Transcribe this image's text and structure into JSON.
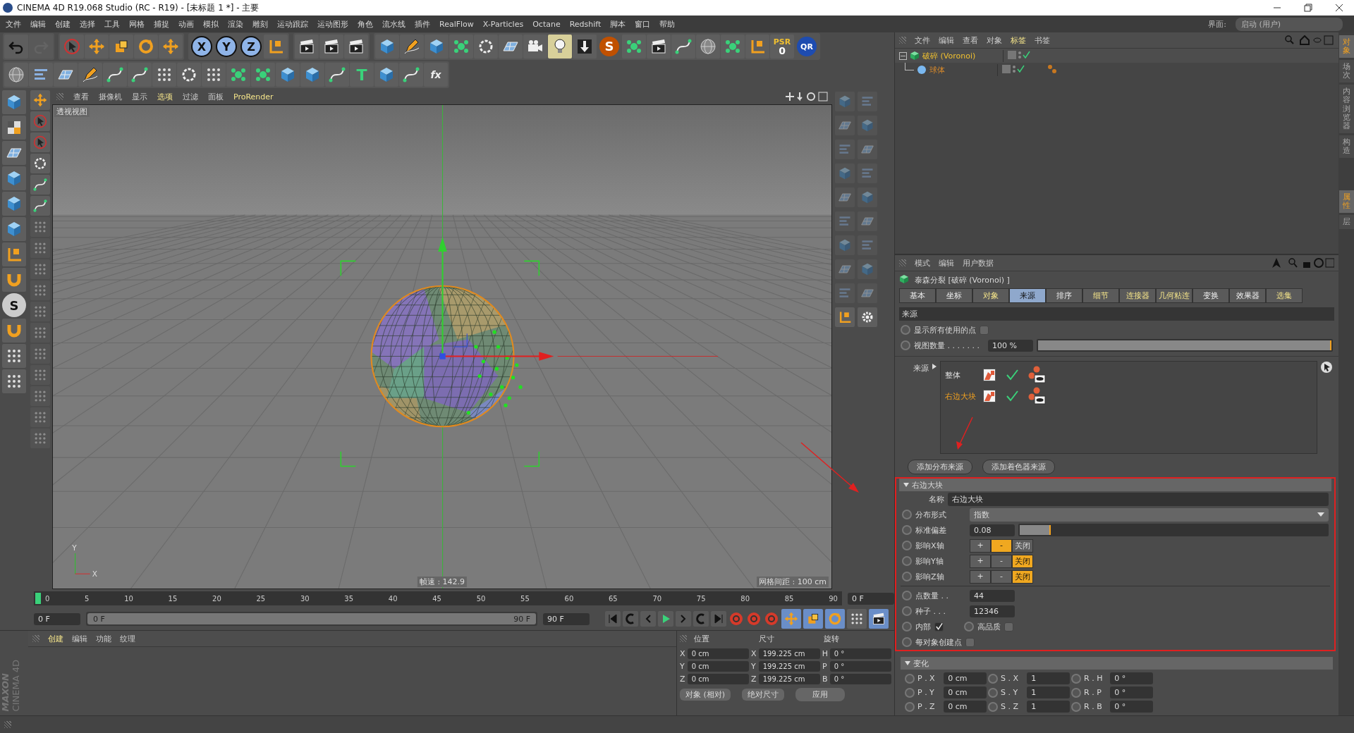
{
  "window": {
    "title": "CINEMA 4D R19.068 Studio (RC - R19) - [未标题 1 *] - 主要"
  },
  "menu": [
    "文件",
    "编辑",
    "创建",
    "选择",
    "工具",
    "网格",
    "捕捉",
    "动画",
    "模拟",
    "渲染",
    "雕刻",
    "运动跟踪",
    "运动图形",
    "角色",
    "流水线",
    "插件",
    "RealFlow",
    "X-Particles",
    "Octane",
    "Redshift",
    "脚本",
    "窗口",
    "帮助"
  ],
  "layout_selector": {
    "label": "界面:",
    "value": "启动 (用户)"
  },
  "toolbar": {
    "axis_buttons": [
      {
        "label": "X",
        "selected": true
      },
      {
        "label": "Y",
        "selected": true
      },
      {
        "label": "Z",
        "selected": true
      }
    ],
    "s_logo": "S",
    "psr": {
      "label": "PSR",
      "value": "0"
    },
    "qr": "QR",
    "text_tool": "T",
    "fx": "fx",
    "left_s": "S"
  },
  "viewport": {
    "menu": [
      {
        "label": "查看",
        "highlighted": false
      },
      {
        "label": "摄像机",
        "highlighted": false
      },
      {
        "label": "显示",
        "highlighted": false
      },
      {
        "label": "选项",
        "highlighted": true
      },
      {
        "label": "过滤",
        "highlighted": false
      },
      {
        "label": "面板",
        "highlighted": false
      },
      {
        "label": "ProRender",
        "highlighted": true
      }
    ],
    "view_name": "透视视图",
    "fps": "帧速 : 142.9",
    "grid_spacing": "网格间距 : 100 cm",
    "axis_labels": [
      "Y",
      "X"
    ]
  },
  "timeline": {
    "ticks": [
      "0",
      "5",
      "10",
      "15",
      "20",
      "25",
      "30",
      "35",
      "40",
      "45",
      "50",
      "55",
      "60",
      "65",
      "70",
      "75",
      "80",
      "85",
      "90"
    ],
    "current_frame": "0 F"
  },
  "transport": {
    "start": "0 F",
    "range": {
      "start": "0 F",
      "end": "90 F",
      "level": 1.0
    },
    "end": "90 F"
  },
  "material_manager": {
    "brand": [
      "MAXON",
      "CINEMA 4D"
    ],
    "menu": [
      {
        "label": "创建",
        "highlighted": true
      },
      {
        "label": "编辑",
        "highlighted": false
      },
      {
        "label": "功能",
        "highlighted": false
      },
      {
        "label": "纹理",
        "highlighted": false
      }
    ]
  },
  "coordinates": {
    "headers": [
      "位置",
      "尺寸",
      "旋转"
    ],
    "rows": [
      {
        "pos_axis": "X",
        "pos": "0 cm",
        "size_axis": "X",
        "size": "199.225 cm",
        "rot_axis": "H",
        "rot": "0 °"
      },
      {
        "pos_axis": "Y",
        "pos": "0 cm",
        "size_axis": "Y",
        "size": "199.225 cm",
        "rot_axis": "P",
        "rot": "0 °"
      },
      {
        "pos_axis": "Z",
        "pos": "0 cm",
        "size_axis": "Z",
        "size": "199.225 cm",
        "rot_axis": "B",
        "rot": "0 °"
      }
    ],
    "mode": "对象 (相对)",
    "size_mode": "绝对尺寸",
    "apply": "应用"
  },
  "object_manager": {
    "menu": [
      {
        "label": "文件",
        "highlighted": false
      },
      {
        "label": "编辑",
        "highlighted": false
      },
      {
        "label": "查看",
        "highlighted": false
      },
      {
        "label": "对象",
        "highlighted": false
      },
      {
        "label": "标签",
        "highlighted": true
      },
      {
        "label": "书签",
        "highlighted": false
      }
    ],
    "objects": [
      {
        "name": "破碎 (Voronoi)",
        "expanded": true,
        "children": [
          {
            "name": "球体"
          }
        ]
      }
    ]
  },
  "side_tabs_top": [
    {
      "label": "对象",
      "selected": true
    },
    {
      "label": "场次",
      "selected": false
    },
    {
      "label": "内容浏览器",
      "selected": false
    },
    {
      "label": "构造",
      "selected": false
    }
  ],
  "side_tabs_bottom": [
    {
      "label": "属性",
      "selected": true
    },
    {
      "label": "层",
      "selected": false
    }
  ],
  "attributes": {
    "menu": [
      "模式",
      "编辑",
      "用户数据"
    ],
    "title": "泰森分裂 [破碎 (Voronoi) ]",
    "tabs": [
      {
        "label": "基本",
        "selected": false,
        "highlighted": false
      },
      {
        "label": "坐标",
        "selected": false,
        "highlighted": false
      },
      {
        "label": "对象",
        "selected": false,
        "highlighted": true
      },
      {
        "label": "来源",
        "selected": true,
        "highlighted": false
      },
      {
        "label": "排序",
        "selected": false,
        "highlighted": false
      },
      {
        "label": "细节",
        "selected": false,
        "highlighted": true
      },
      {
        "label": "连接器",
        "selected": false,
        "highlighted": true
      },
      {
        "label": "几何粘连",
        "selected": false,
        "highlighted": true
      },
      {
        "label": "变换",
        "selected": false,
        "highlighted": false
      },
      {
        "label": "效果器",
        "selected": false,
        "highlighted": false
      },
      {
        "label": "选集",
        "selected": false,
        "highlighted": true
      }
    ],
    "section": "来源",
    "show_all_points": {
      "label": "显示所有使用的点",
      "checked": false
    },
    "view_amount": {
      "label": "视图数量 . . . . . . .",
      "value": "100 %",
      "level": 1.0
    },
    "sources_label": "来源",
    "sources": [
      {
        "name": "整体",
        "selected": false
      },
      {
        "name": "右边大块",
        "selected": true
      }
    ],
    "buttons": [
      "添加分布来源",
      "添加着色器来源"
    ],
    "detail": {
      "title": "右边大块",
      "name_label": "名称",
      "name_value": "右边大块",
      "distribution": {
        "label": "分布形式",
        "value": "指数"
      },
      "std_dev": {
        "label": "标准偏差",
        "value": "0.08",
        "level": 0.1
      },
      "axes": [
        {
          "label": "影响X轴",
          "options": [
            {
              "label": "+",
              "selected": false
            },
            {
              "label": "-",
              "selected": true
            },
            {
              "label": "关闭",
              "selected": false
            }
          ]
        },
        {
          "label": "影响Y轴",
          "options": [
            {
              "label": "+",
              "selected": false
            },
            {
              "label": "-",
              "selected": false
            },
            {
              "label": "关闭",
              "selected": true
            }
          ]
        },
        {
          "label": "影响Z轴",
          "options": [
            {
              "label": "+",
              "selected": false
            },
            {
              "label": "-",
              "selected": false
            },
            {
              "label": "关闭",
              "selected": true
            }
          ]
        }
      ],
      "point_count": {
        "label": "点数量 . .",
        "value": "44"
      },
      "seed": {
        "label": "种子 . . .",
        "value": "12346"
      },
      "inside": {
        "label": "内部",
        "checked": true
      },
      "high_quality": {
        "label": "高品质",
        "checked": false
      },
      "per_object": {
        "label": "每对象创建点",
        "checked": false
      }
    },
    "transform": {
      "title": "变化",
      "fields": [
        {
          "label": "P . X",
          "value": "0 cm"
        },
        {
          "label": "S . X",
          "value": "1"
        },
        {
          "label": "R . H",
          "value": "0 °"
        },
        {
          "label": "P . Y",
          "value": "0 cm"
        },
        {
          "label": "S . Y",
          "value": "1"
        },
        {
          "label": "R . P",
          "value": "0 °"
        },
        {
          "label": "P . Z",
          "value": "0 cm"
        },
        {
          "label": "S . Z",
          "value": "1"
        },
        {
          "label": "R . B",
          "value": "0 °"
        }
      ]
    }
  }
}
